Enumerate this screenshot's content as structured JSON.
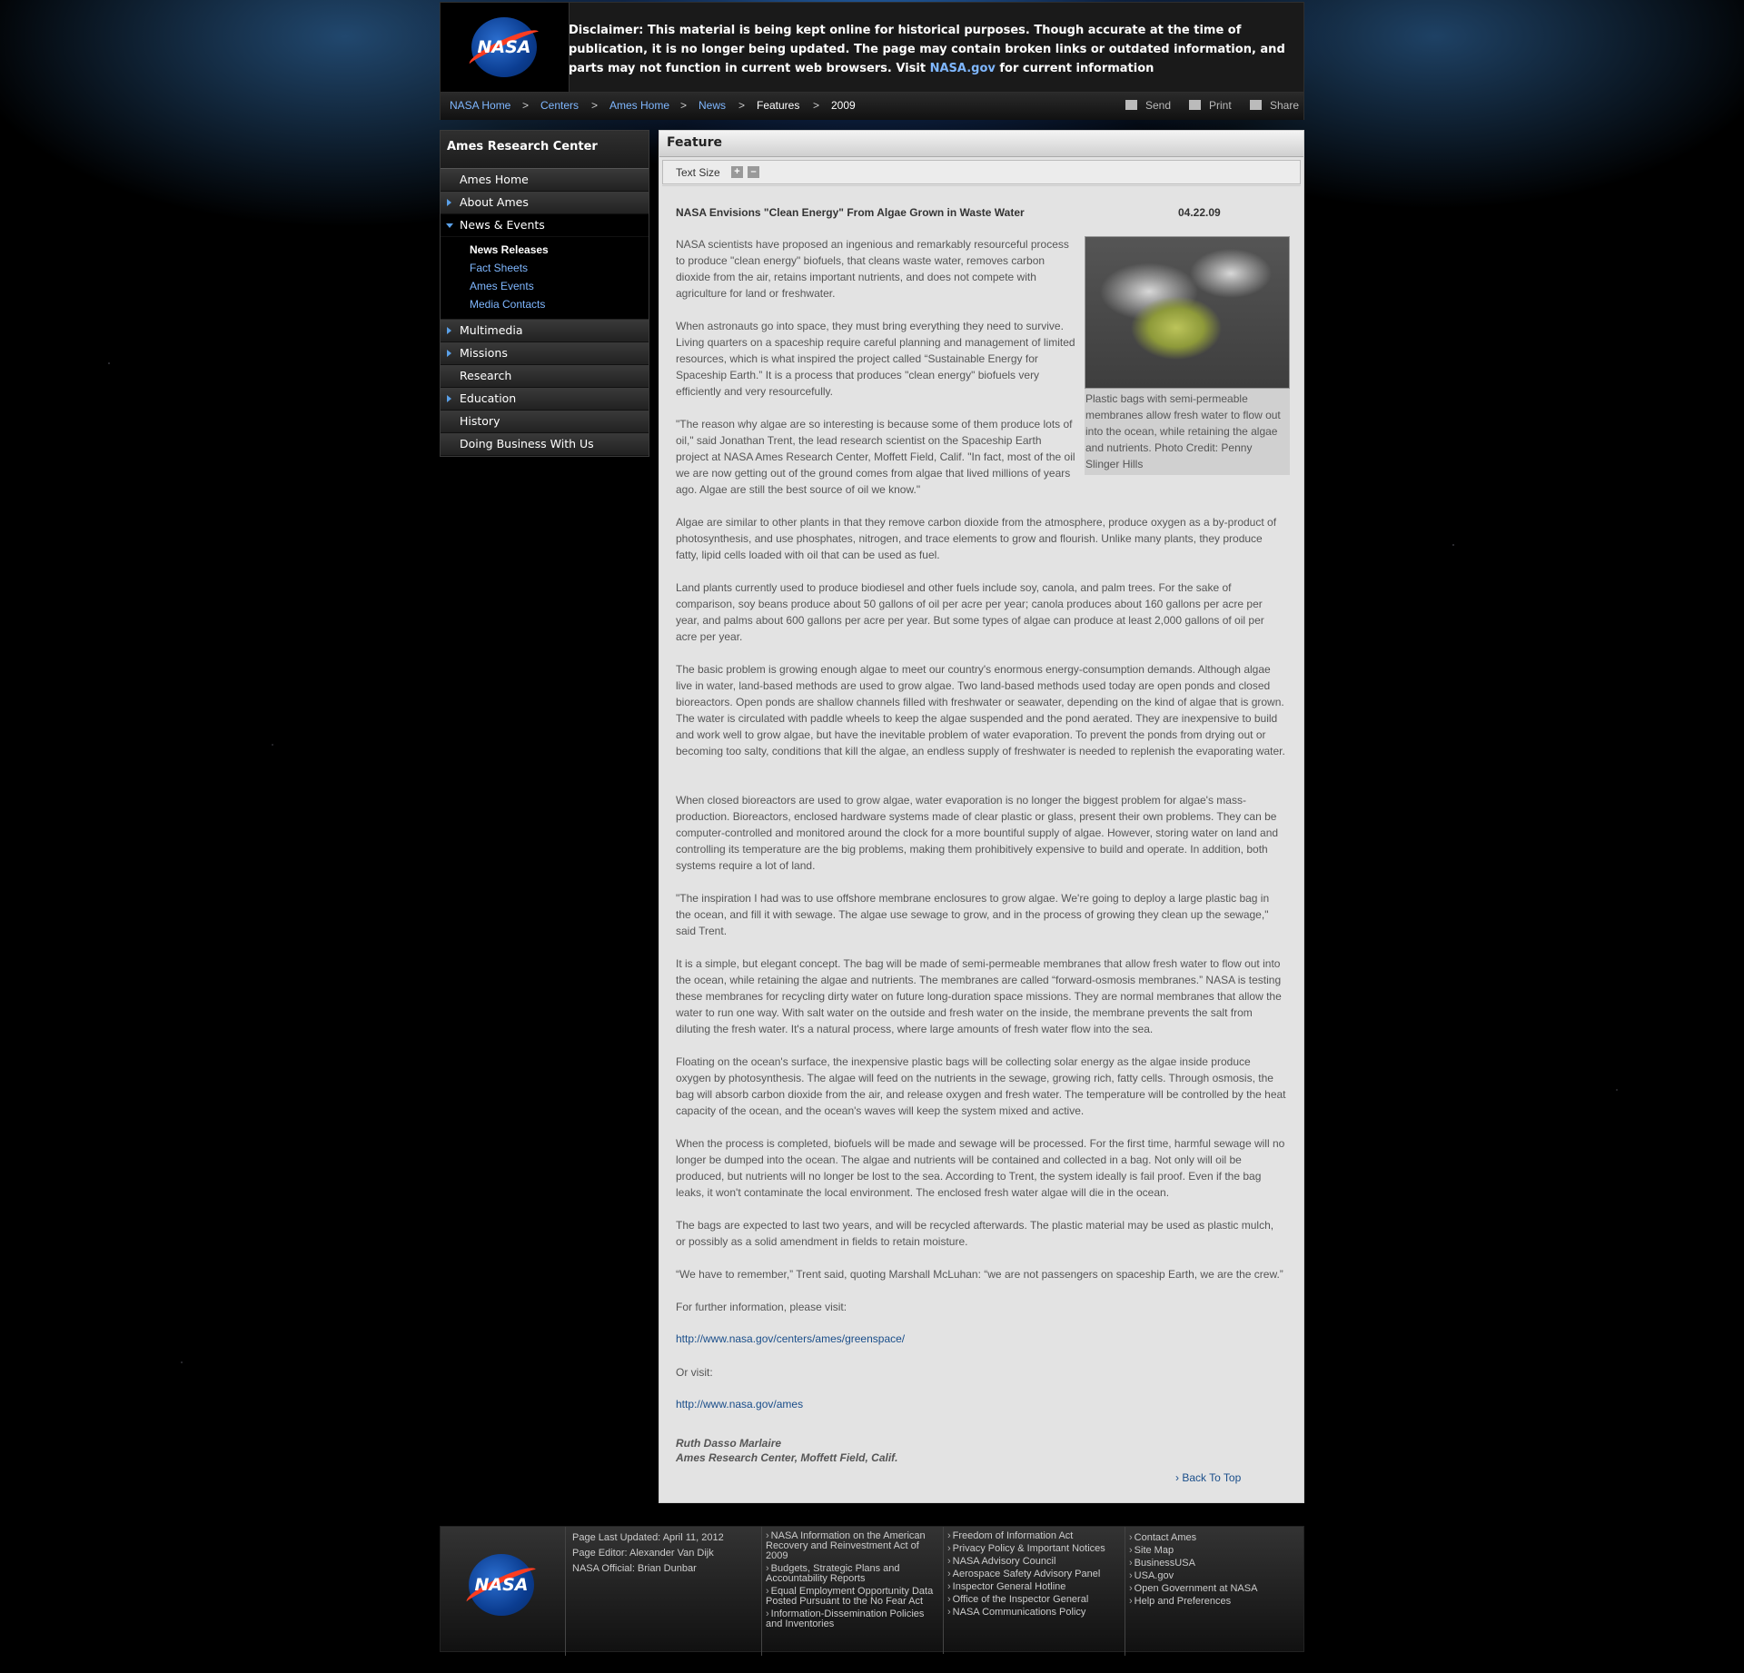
{
  "header": {
    "logo_text": "NASA",
    "disclaimer": "Disclaimer: This material is being kept online for historical purposes. Though accurate at the time of publication, it is no longer being updated. The page may contain broken links or outdated information, and parts may not function in current web browsers. Visit ",
    "disclaimer_link": "NASA.gov",
    "disclaimer_tail": " for current information"
  },
  "breadcrumbs": {
    "items": [
      "NASA Home",
      "Centers",
      "Ames Home",
      "News",
      "Features",
      "2009"
    ],
    "separator": ">",
    "tools": [
      "Send",
      "Print",
      "Share"
    ]
  },
  "sidebar": {
    "title": "Ames Research Center",
    "items": [
      "Ames Home",
      "About Ames",
      "News & Events",
      "Multimedia",
      "Missions",
      "Research",
      "Education",
      "History",
      "Doing Business With Us"
    ],
    "sub_items": [
      "News Releases",
      "Fact Sheets",
      "Ames Events",
      "Media Contacts"
    ]
  },
  "content": {
    "heading": "Feature",
    "text_size_label": "Text Size",
    "text_size_plus": "+",
    "text_size_minus": "–",
    "title": "NASA Envisions \"Clean Energy\" From Algae Grown in Waste Water",
    "date": "04.22.09",
    "photo_caption": "Plastic bags with semi-permeable membranes allow fresh water to flow out into the ocean, while retaining the algae and nutrients. Photo Credit: Penny Slinger Hills",
    "paragraphs": [
      "NASA scientists have proposed an ingenious and remarkably resourceful process to produce \"clean energy\" biofuels, that cleans waste water, removes carbon dioxide from the air, retains important nutrients, and does not compete with agriculture for land or freshwater.",
      "When astronauts go into space, they must bring everything they need to survive. Living quarters on a spaceship require careful planning and management of limited resources, which is what inspired the project called “Sustainable Energy for Spaceship Earth.” It is a process that produces \"clean energy\" biofuels very efficiently and very resourcefully.",
      "\"The reason why algae are so interesting is because some of them produce lots of oil,\" said Jonathan Trent, the lead research scientist on the Spaceship Earth project at NASA Ames Research Center, Moffett Field, Calif. \"In fact, most of the oil we are now getting out of the ground comes from algae that lived millions of years ago. Algae are still the best source of oil we know.\"",
      "Algae are similar to other plants in that they remove carbon dioxide from the atmosphere, produce oxygen as a by-product of photosynthesis, and use phosphates, nitrogen, and trace elements to grow and flourish. Unlike many plants, they produce fatty, lipid cells loaded with oil that can be used as fuel.",
      "Land plants currently used to produce biodiesel and other fuels include soy, canola, and palm trees. For the sake of comparison, soy beans produce about 50 gallons of oil per acre per year; canola produces about 160 gallons per acre per year, and palms about 600 gallons per acre per year. But some types of algae can produce at least 2,000 gallons of oil per acre per year.",
      "The basic problem is growing enough algae to meet our country's enormous energy-consumption demands. Although algae live in water, land-based methods are used to grow algae. Two land-based methods used today are open ponds and closed bioreactors. Open ponds are shallow channels filled with freshwater or seawater, depending on the kind of algae that is grown. The water is circulated with paddle wheels to keep the algae suspended and the pond aerated. They are inexpensive to build and work well to grow algae, but have the inevitable problem of water evaporation. To prevent the ponds from drying out or becoming too salty, conditions that kill the algae, an endless supply of freshwater is needed to replenish the evaporating water.",
      "When closed bioreactors are used to grow algae, water evaporation is no longer the biggest problem for algae's mass-production. Bioreactors, enclosed hardware systems made of clear plastic or glass, present their own problems. They can be computer-controlled and monitored around the clock for a more bountiful supply of algae. However, storing water on land and controlling its temperature are the big problems, making them prohibitively expensive to build and operate. In addition, both systems require a lot of land.",
      "\"The inspiration I had was to use offshore membrane enclosures to grow algae. We're going to deploy a large plastic bag in the ocean, and fill it with sewage. The algae use sewage to grow, and in the process of growing they clean up the sewage,\" said Trent.",
      "It is a simple, but elegant concept. The bag will be made of semi-permeable membranes that allow fresh water to flow out into the ocean, while retaining the algae and nutrients. The membranes are called “forward-osmosis membranes.” NASA is testing these membranes for recycling dirty water on future long-duration space missions. They are normal membranes that allow the water to run one way. With salt water on the outside and fresh water on the inside, the membrane prevents the salt from diluting the fresh water. It's a natural process, where large amounts of fresh water flow into the sea.",
      "Floating on the ocean's surface, the inexpensive plastic bags will be collecting solar energy as the algae inside produce oxygen by photosynthesis. The algae will feed on the nutrients in the sewage, growing rich, fatty cells. Through osmosis, the bag will absorb carbon dioxide from the air, and release oxygen and fresh water. The temperature will be controlled by the heat capacity of the ocean, and the ocean's waves will keep the system mixed and active.",
      "When the process is completed, biofuels will be made and sewage will be processed. For the first time, harmful sewage will no longer be dumped into the ocean. The algae and nutrients will be contained and collected in a bag. Not only will oil be produced, but nutrients will no longer be lost to the sea. According to Trent, the system ideally is fail proof. Even if the bag leaks, it won't contaminate the local environment. The enclosed fresh water algae will die in the ocean.",
      "The bags are expected to last two years, and will be recycled afterwards. The plastic material may be used as plastic mulch, or possibly as a solid amendment in fields to retain moisture.",
      "“We have to remember,” Trent said, quoting Marshall McLuhan: “we are not passengers on spaceship Earth, we are the crew.”",
      "For further information, please visit:",
      "Or visit:"
    ],
    "links": [
      "http://www.nasa.gov/centers/ames/greenspace/",
      "http://www.nasa.gov/ames"
    ],
    "author": "Ruth Dasso Marlaire",
    "author_org": "Ames Research Center, Moffett Field, Calif.",
    "back_to_top": "› Back To Top"
  },
  "footer": {
    "meta": [
      "Page Last Updated: April 11, 2012",
      "Page Editor: Alexander Van Dijk",
      "NASA Official: Brian Dunbar"
    ],
    "col1": [
      "NASA Information on the American Recovery and Reinvestment Act of 2009",
      "Budgets, Strategic Plans and Accountability Reports",
      "Equal Employment Opportunity Data Posted Pursuant to the No Fear Act",
      "Information-Dissemination Policies and Inventories"
    ],
    "col2": [
      "Freedom of Information Act",
      "Privacy Policy & Important Notices",
      "NASA Advisory Council",
      "Aerospace Safety Advisory Panel",
      "Inspector General Hotline",
      "Office of the Inspector General",
      "NASA Communications Policy"
    ],
    "col3": [
      "Contact Ames",
      "Site Map",
      "BusinessUSA",
      "USA.gov",
      "Open Government at NASA",
      "Help and Preferences"
    ]
  }
}
